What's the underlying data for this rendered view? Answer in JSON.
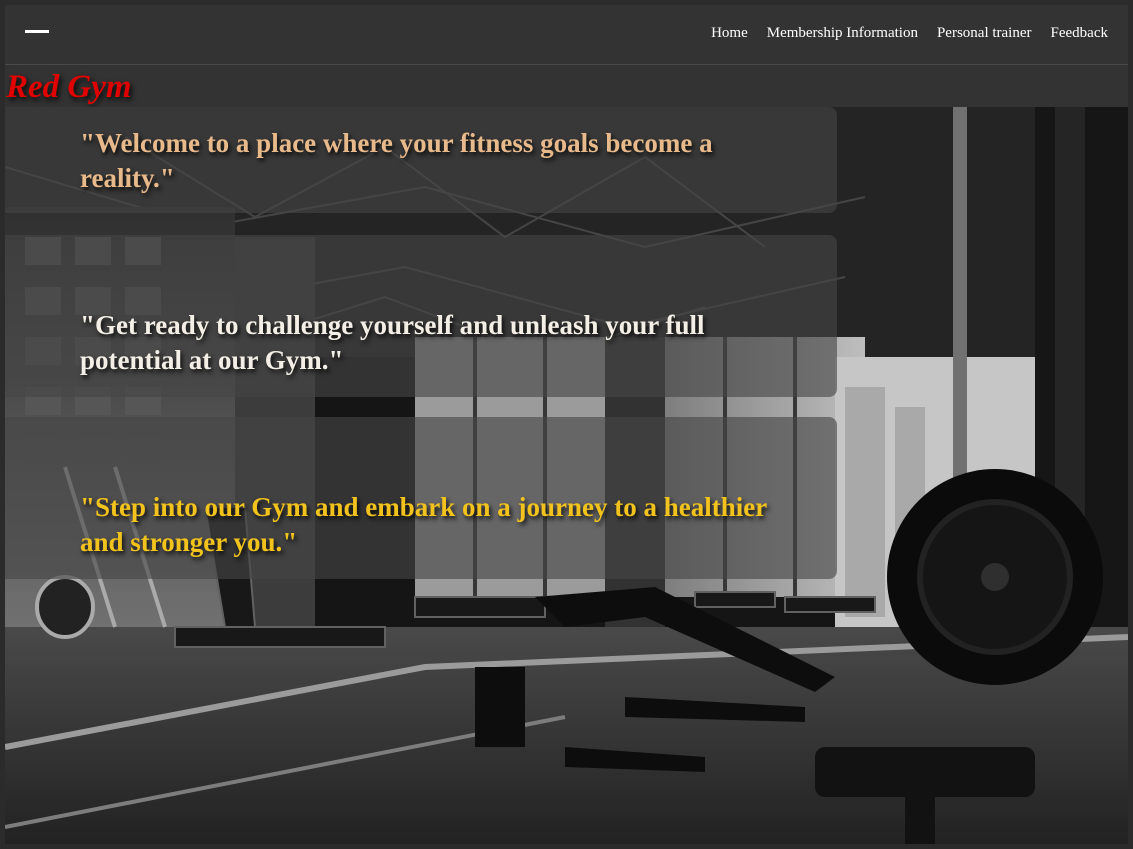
{
  "nav": {
    "menu_icon": "hamburger-menu-icon",
    "items": [
      {
        "label": "Home"
      },
      {
        "label": "Membership Information"
      },
      {
        "label": "Personal trainer"
      },
      {
        "label": "Feedback"
      }
    ]
  },
  "brand": {
    "name": "Red Gym",
    "color": "#e00000"
  },
  "quotes": [
    {
      "text": "\"Welcome to a place where your fitness goals become a reality.\"",
      "color": "#e8b98a"
    },
    {
      "text": "\"Get ready to challenge yourself and unleash your full potential at our Gym.\"",
      "color": "#f4efe6"
    },
    {
      "text": "\"Step into our Gym and embark on a journey to a healthier and stronger you.\"",
      "color": "#f2c31c"
    }
  ]
}
